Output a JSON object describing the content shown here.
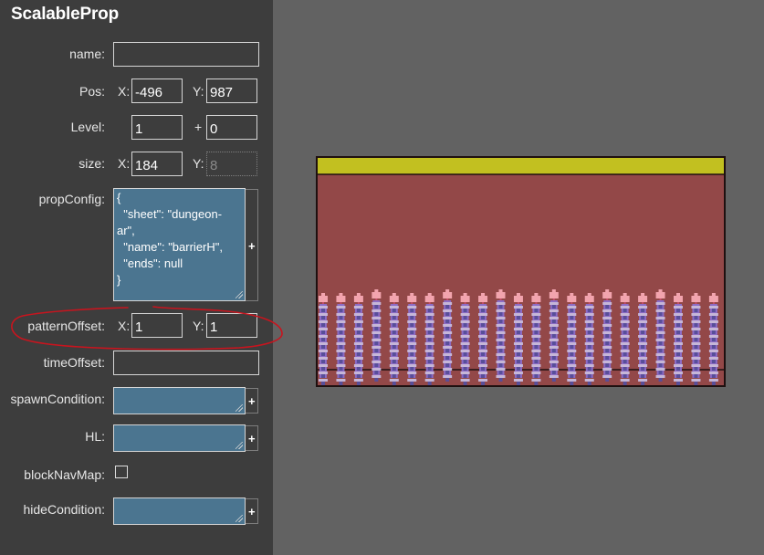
{
  "panel": {
    "title": "ScalableProp",
    "fields": {
      "name": {
        "label": "name:",
        "value": ""
      },
      "pos": {
        "label": "Pos:",
        "x_label": "X:",
        "x": "-496",
        "y_label": "Y:",
        "y": "987"
      },
      "level": {
        "label": "Level:",
        "value": "1",
        "plus_label": "+",
        "offset": "0"
      },
      "size": {
        "label": "size:",
        "x_label": "X:",
        "x": "184",
        "y_label": "Y:",
        "y": "8"
      },
      "propConfig": {
        "label": "propConfig:",
        "value": "{\n  \"sheet\": \"dungeon-\nar\",\n  \"name\": \"barrierH\",\n  \"ends\": null\n}",
        "add": "+"
      },
      "patternOffset": {
        "label": "patternOffset:",
        "x_label": "X:",
        "x": "1",
        "y_label": "Y:",
        "y": "1"
      },
      "timeOffset": {
        "label": "timeOffset:",
        "value": ""
      },
      "spawnCondition": {
        "label": "spawnCondition:",
        "value": "",
        "add": "+"
      },
      "HL": {
        "label": "HL:",
        "value": "",
        "add": "+"
      },
      "blockNavMap": {
        "label": "blockNavMap:",
        "checked": false
      },
      "hideCondition": {
        "label": "hideCondition:",
        "value": "",
        "add": "+"
      }
    }
  },
  "annotation": {
    "color": "#c8141e",
    "encircles": "patternOffset"
  },
  "preview": {
    "colors": {
      "top_bar": "#c2c020",
      "wall": "#934848",
      "outline": "#1e1010",
      "bar_purple": "#8c6cc6",
      "bar_light": "#c6b6d8",
      "bar_dark": "#584e9a",
      "crystal": "#f2a4ae",
      "crystal_shade": "#c44c6a"
    },
    "pillar_count": 23,
    "tall_pillars": [
      3,
      7,
      10,
      13,
      16,
      19
    ]
  }
}
